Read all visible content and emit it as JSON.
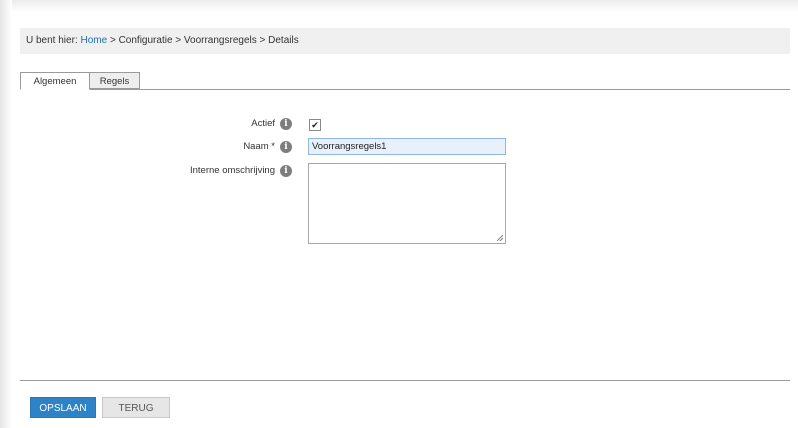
{
  "breadcrumb": {
    "prefix": "U bent hier:",
    "home": "Home",
    "sep1": ">",
    "item1": "Configuratie",
    "sep2": ">",
    "item2": "Voorrangsregels",
    "sep3": ">",
    "item3": "Details"
  },
  "tabs": [
    {
      "label": "Algemeen",
      "active": true
    },
    {
      "label": "Regels",
      "active": false
    }
  ],
  "form": {
    "actief_label": "Actief",
    "actief_checked": true,
    "checkmark": "✔",
    "naam_label": "Naam *",
    "naam_value": "Voorrangsregels1",
    "omschrijving_label": "Interne omschrijving",
    "omschrijving_value": "",
    "info_glyph": "i"
  },
  "buttons": {
    "save_label": "OPSLAAN",
    "back_label": "TERUG"
  },
  "colors": {
    "accent": "#2e83c6",
    "link": "#1f6fb5",
    "breadcrumb_bg": "#f0f0f0"
  }
}
